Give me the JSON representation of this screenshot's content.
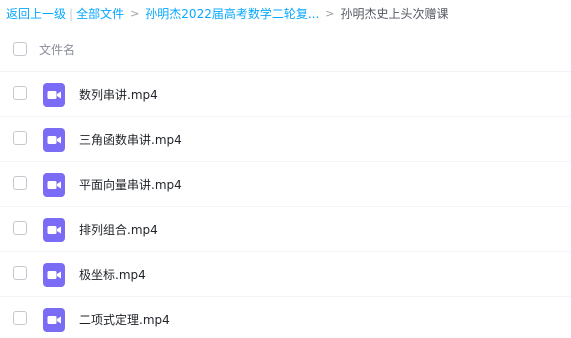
{
  "breadcrumb": {
    "back": "返回上一级",
    "separator_bar": "|",
    "all_files": "全部文件",
    "sep": ">",
    "folder": "孙明杰2022届高考数学二轮复...",
    "current": "孙明杰史上头次赠课"
  },
  "header": {
    "column_label": "文件名"
  },
  "files": [
    {
      "name": "数列串讲.mp4",
      "icon": "video-file-icon"
    },
    {
      "name": "三角函数串讲.mp4",
      "icon": "video-file-icon"
    },
    {
      "name": "平面向量串讲.mp4",
      "icon": "video-file-icon"
    },
    {
      "name": "排列组合.mp4",
      "icon": "video-file-icon"
    },
    {
      "name": "极坐标.mp4",
      "icon": "video-file-icon"
    },
    {
      "name": "二项式定理.mp4",
      "icon": "video-file-icon"
    }
  ],
  "colors": {
    "link": "#06a7ff",
    "icon_purple": "#7a6cf5"
  }
}
